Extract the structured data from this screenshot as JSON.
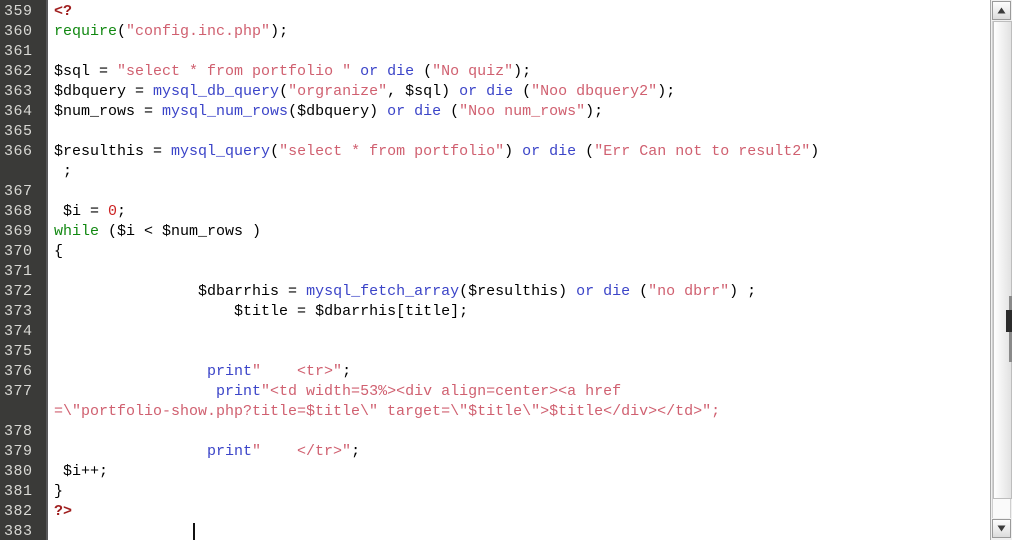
{
  "editor": {
    "language": "php",
    "gutter_bg": "#3a3a38",
    "gutter_fg": "#d8d8d4",
    "code_bg": "#ffffff",
    "caret_visible": true,
    "first_line_number": 359,
    "last_line_number": 383,
    "lines": [
      {
        "number": "359",
        "tokens": [
          {
            "t": "<?",
            "c": "t-php"
          }
        ]
      },
      {
        "number": "360",
        "tokens": [
          {
            "t": "require",
            "c": "t-kw"
          },
          {
            "t": "(",
            "c": "t-plain"
          },
          {
            "t": "\"config.inc.php\"",
            "c": "t-str"
          },
          {
            "t": ");",
            "c": "t-plain"
          }
        ]
      },
      {
        "number": "361",
        "tokens": []
      },
      {
        "number": "362",
        "tokens": [
          {
            "t": "$sql ",
            "c": "t-var"
          },
          {
            "t": "= ",
            "c": "t-op"
          },
          {
            "t": "\"select * from portfolio \" ",
            "c": "t-str"
          },
          {
            "t": "or die ",
            "c": "t-blue"
          },
          {
            "t": "(",
            "c": "t-plain"
          },
          {
            "t": "\"No quiz\"",
            "c": "t-str"
          },
          {
            "t": ");",
            "c": "t-plain"
          }
        ]
      },
      {
        "number": "363",
        "tokens": [
          {
            "t": "$dbquery ",
            "c": "t-var"
          },
          {
            "t": "= ",
            "c": "t-op"
          },
          {
            "t": "mysql_db_query",
            "c": "t-fn"
          },
          {
            "t": "(",
            "c": "t-plain"
          },
          {
            "t": "\"orgranize\"",
            "c": "t-str"
          },
          {
            "t": ", $sql) ",
            "c": "t-plain"
          },
          {
            "t": "or die ",
            "c": "t-blue"
          },
          {
            "t": "(",
            "c": "t-plain"
          },
          {
            "t": "\"Noo dbquery2\"",
            "c": "t-str"
          },
          {
            "t": ");",
            "c": "t-plain"
          }
        ]
      },
      {
        "number": "364",
        "tokens": [
          {
            "t": "$num_rows ",
            "c": "t-var"
          },
          {
            "t": "= ",
            "c": "t-op"
          },
          {
            "t": "mysql_num_rows",
            "c": "t-fn"
          },
          {
            "t": "($dbquery) ",
            "c": "t-plain"
          },
          {
            "t": "or die ",
            "c": "t-blue"
          },
          {
            "t": "(",
            "c": "t-plain"
          },
          {
            "t": "\"Noo num_rows\"",
            "c": "t-str"
          },
          {
            "t": ");",
            "c": "t-plain"
          }
        ]
      },
      {
        "number": "365",
        "tokens": []
      },
      {
        "number": "366",
        "tokens": [
          {
            "t": "$resulthis ",
            "c": "t-var"
          },
          {
            "t": "= ",
            "c": "t-op"
          },
          {
            "t": "mysql_query",
            "c": "t-fn"
          },
          {
            "t": "(",
            "c": "t-plain"
          },
          {
            "t": "\"select * from portfolio\"",
            "c": "t-str"
          },
          {
            "t": ") ",
            "c": "t-plain"
          },
          {
            "t": "or die ",
            "c": "t-blue"
          },
          {
            "t": "(",
            "c": "t-plain"
          },
          {
            "t": "\"Err Can not to result2\"",
            "c": "t-str"
          },
          {
            "t": ")",
            "c": "t-plain"
          }
        ]
      },
      {
        "number": "",
        "wrapped": true,
        "tokens": [
          {
            "t": " ;",
            "c": "t-plain"
          }
        ]
      },
      {
        "number": "367",
        "tokens": []
      },
      {
        "number": "368",
        "tokens": [
          {
            "t": " $i ",
            "c": "t-var"
          },
          {
            "t": "= ",
            "c": "t-op"
          },
          {
            "t": "0",
            "c": "t-num"
          },
          {
            "t": ";",
            "c": "t-plain"
          }
        ]
      },
      {
        "number": "369",
        "tokens": [
          {
            "t": "while ",
            "c": "t-kw"
          },
          {
            "t": "($i ",
            "c": "t-plain"
          },
          {
            "t": "< ",
            "c": "t-op"
          },
          {
            "t": "$num_rows )",
            "c": "t-plain"
          }
        ]
      },
      {
        "number": "370",
        "tokens": [
          {
            "t": "{",
            "c": "t-plain"
          }
        ]
      },
      {
        "number": "371",
        "tokens": []
      },
      {
        "number": "372",
        "tokens": [
          {
            "t": "                $dbarrhis ",
            "c": "t-var"
          },
          {
            "t": "= ",
            "c": "t-op"
          },
          {
            "t": "mysql_fetch_array",
            "c": "t-fn"
          },
          {
            "t": "($resulthis) ",
            "c": "t-plain"
          },
          {
            "t": "or die ",
            "c": "t-blue"
          },
          {
            "t": "(",
            "c": "t-plain"
          },
          {
            "t": "\"no dbrr\"",
            "c": "t-str"
          },
          {
            "t": ") ;",
            "c": "t-plain"
          }
        ]
      },
      {
        "number": "373",
        "tokens": [
          {
            "t": "                    $title ",
            "c": "t-var"
          },
          {
            "t": "= ",
            "c": "t-op"
          },
          {
            "t": "$dbarrhis[title];",
            "c": "t-plain"
          }
        ]
      },
      {
        "number": "374",
        "tokens": []
      },
      {
        "number": "375",
        "tokens": []
      },
      {
        "number": "376",
        "tokens": [
          {
            "t": "                 ",
            "c": "t-plain"
          },
          {
            "t": "print",
            "c": "t-blue"
          },
          {
            "t": "\"    <tr>\"",
            "c": "t-str"
          },
          {
            "t": ";",
            "c": "t-plain"
          }
        ]
      },
      {
        "number": "377",
        "tokens": [
          {
            "t": "                  ",
            "c": "t-plain"
          },
          {
            "t": "print",
            "c": "t-blue"
          },
          {
            "t": "\"<td width=53%><div align=center><a href",
            "c": "t-str"
          }
        ]
      },
      {
        "number": "",
        "wrapped": true,
        "tokens": [
          {
            "t": "=\\\"portfolio-show.php?title=$title\\\" target=\\\"$title\\\">$title</div></td>\";",
            "c": "t-str"
          }
        ]
      },
      {
        "number": "378",
        "tokens": []
      },
      {
        "number": "379",
        "tokens": [
          {
            "t": "                 ",
            "c": "t-plain"
          },
          {
            "t": "print",
            "c": "t-blue"
          },
          {
            "t": "\"    </tr>\"",
            "c": "t-str"
          },
          {
            "t": ";",
            "c": "t-plain"
          }
        ]
      },
      {
        "number": "380",
        "tokens": [
          {
            "t": " $i++;",
            "c": "t-plain"
          }
        ]
      },
      {
        "number": "381",
        "tokens": [
          {
            "t": "}",
            "c": "t-plain"
          }
        ]
      },
      {
        "number": "382",
        "tokens": [
          {
            "t": "?>",
            "c": "t-php"
          }
        ]
      },
      {
        "number": "383",
        "tokens": []
      }
    ]
  },
  "scrollbar": {
    "orientation": "vertical",
    "up_arrow": "▲",
    "down_arrow": "▼",
    "thumb_present": true
  }
}
